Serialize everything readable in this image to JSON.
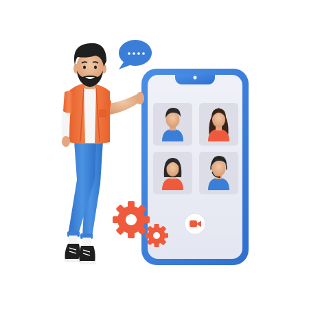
{
  "scene": {
    "kind": "video-call-illustration",
    "colors": {
      "phone_frame": "#3b7ed8",
      "phone_screen": "#eceef7",
      "tile_bg": "#dcdde6",
      "shirt_orange": "#f2713a",
      "pants_blue": "#3f87d8",
      "skin": "#e8b58e",
      "hair": "#222222",
      "gear": "#f05a3c",
      "bubble": "#3b7ed8",
      "camera_icon": "#f05a3c"
    },
    "icons": {
      "chat_bubble": "chat-bubble-icon",
      "gear_large": "gear-icon",
      "gear_small": "gear-icon",
      "video_call": "video-camera-icon"
    },
    "participants": [
      {
        "name": "participant-man-short-hair",
        "shirt": "#3b7ed8",
        "hair": "#2a2a2a"
      },
      {
        "name": "participant-woman-long-hair",
        "shirt": "#f05a3c",
        "hair": "#3a2418"
      },
      {
        "name": "participant-woman-bob-hair",
        "shirt": "#f05a3c",
        "hair": "#2a2a2a"
      },
      {
        "name": "participant-man-headset",
        "shirt": "#3b7ed8",
        "hair": "#2a2a2a"
      }
    ]
  }
}
